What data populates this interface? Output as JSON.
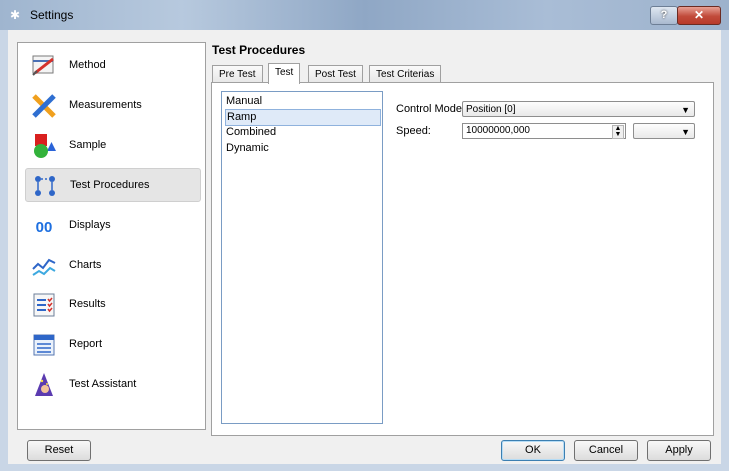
{
  "window": {
    "title": "Settings",
    "help_label": "?",
    "close_label": "✕"
  },
  "sidebar": {
    "items": [
      {
        "label": "Method",
        "icon": "method-icon"
      },
      {
        "label": "Measurements",
        "icon": "measurements-icon"
      },
      {
        "label": "Sample",
        "icon": "sample-icon"
      },
      {
        "label": "Test Procedures",
        "icon": "test-procedures-icon",
        "active": true
      },
      {
        "label": "Displays",
        "icon": "displays-icon"
      },
      {
        "label": "Charts",
        "icon": "charts-icon"
      },
      {
        "label": "Results",
        "icon": "results-icon"
      },
      {
        "label": "Report",
        "icon": "report-icon"
      },
      {
        "label": "Test Assistant",
        "icon": "test-assistant-icon"
      }
    ],
    "displays_glyph": "00"
  },
  "content": {
    "title": "Test Procedures",
    "tabs": [
      "Pre Test",
      "Test",
      "Post Test",
      "Test Criterias"
    ],
    "active_tab": "Test",
    "procedures": [
      "Manual",
      "Ramp",
      "Combined",
      "Dynamic"
    ],
    "selected_procedure": "Ramp",
    "control_mode": {
      "label": "Control Mode:",
      "value": "Position [0]"
    },
    "speed": {
      "label": "Speed:",
      "value": "10000000,000",
      "unit": ""
    }
  },
  "footer": {
    "reset_label": "Reset",
    "ok_label": "OK",
    "cancel_label": "Cancel",
    "apply_label": "Apply"
  },
  "colors": {
    "titlebar": "#a9bdd6",
    "selection": "#dfeaf8",
    "close": "#c14a3a"
  }
}
